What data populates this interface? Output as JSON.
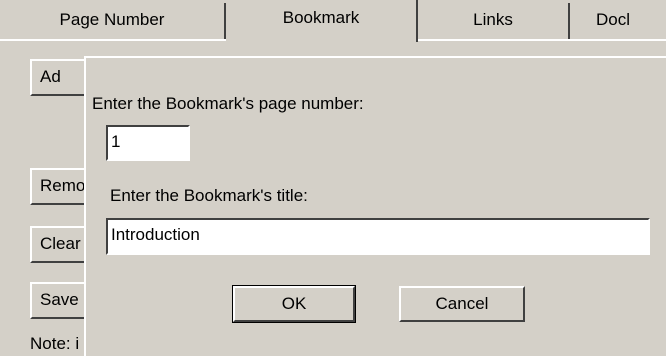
{
  "tabs": [
    {
      "label": "Page Number"
    },
    {
      "label": "Bookmark"
    },
    {
      "label": "Links"
    },
    {
      "label": "Docl"
    }
  ],
  "background_buttons": {
    "add": "Ad",
    "remove": "Remo",
    "clear": "Clear",
    "save": "Save"
  },
  "note_text": "Note: i",
  "dialog": {
    "page_number_label": "Enter the Bookmark's page number:",
    "page_number_value": "1",
    "title_label": "Enter the Bookmark's title:",
    "title_value": "Introduction",
    "ok_label": "OK",
    "cancel_label": "Cancel"
  }
}
